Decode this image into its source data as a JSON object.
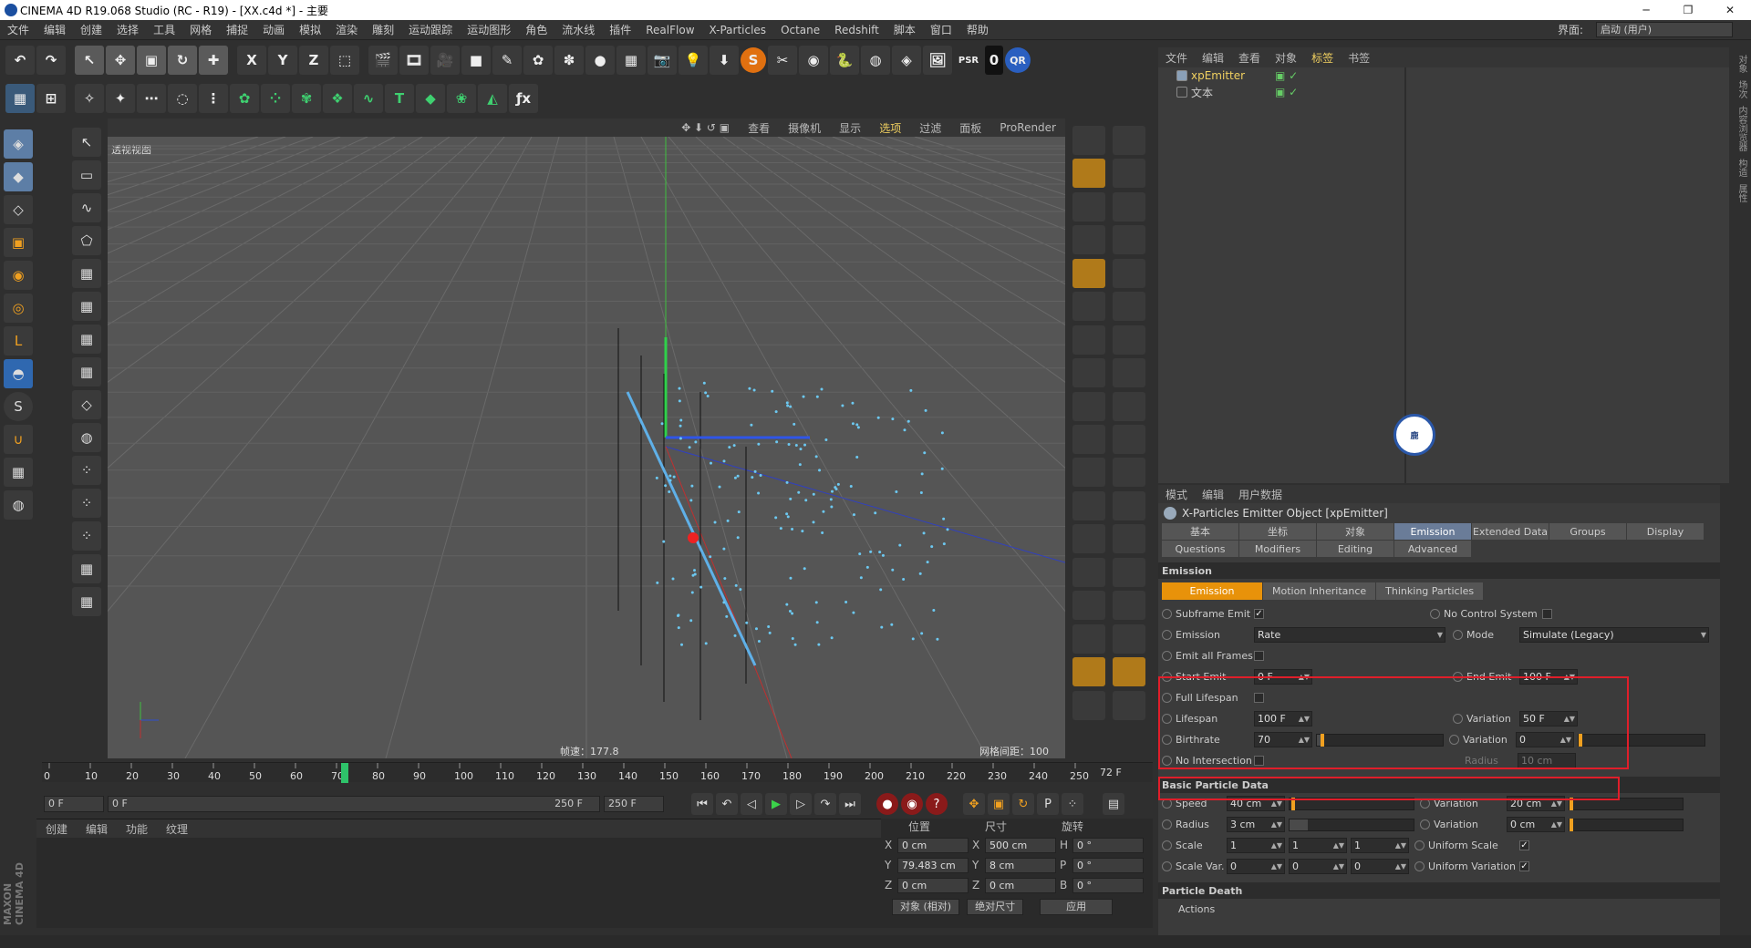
{
  "window": {
    "title": "CINEMA 4D R19.068 Studio (RC - R19) - [XX.c4d *] - 主要",
    "min": "─",
    "max": "❐",
    "close": "✕"
  },
  "menu": [
    "文件",
    "编辑",
    "创建",
    "选择",
    "工具",
    "网格",
    "捕捉",
    "动画",
    "模拟",
    "渲染",
    "雕刻",
    "运动跟踪",
    "运动图形",
    "角色",
    "流水线",
    "插件",
    "RealFlow",
    "X-Particles",
    "Octane",
    "Redshift",
    "脚本",
    "窗口",
    "帮助"
  ],
  "interface": {
    "label": "界面:",
    "value": "启动 (用户)"
  },
  "toolbar1": [
    "↶",
    "↷",
    "↖",
    "✥",
    "▣",
    "↻",
    "✚",
    "X",
    "Y",
    "Z",
    "⬚",
    "🎬",
    "🎞",
    "🎥",
    "■",
    "✎",
    "✿",
    "✽",
    "●",
    "▦",
    "📷",
    "💡",
    "⬇",
    "S",
    "✂",
    "◉",
    "🐍",
    "◍",
    "◈",
    "🖼",
    "PSR",
    "0",
    "QR"
  ],
  "toolbar2": [
    "▦",
    "⊞",
    "✧",
    "✦",
    "⋯",
    "◌",
    "⋮",
    "✿",
    "⁘",
    "✾",
    "❖",
    "∿",
    "T",
    "◆",
    "❀",
    "◭",
    "ƒx"
  ],
  "left_tools": [
    "◈",
    "◆",
    "◇",
    "▣",
    "◉",
    "◎",
    "L",
    "◓",
    "S",
    "∪",
    "▦",
    "◍"
  ],
  "viewport": {
    "menu": [
      "查看",
      "摄像机",
      "显示",
      "选项",
      "过滤",
      "面板",
      "ProRender"
    ],
    "active": "选项",
    "label": "透视视图",
    "speed": "帧速：177.8",
    "grid": "网格间距：100 cm"
  },
  "timeline": {
    "ticks": [
      "0",
      "10",
      "20",
      "30",
      "40",
      "50",
      "60",
      "70",
      "72",
      "80",
      "90",
      "100",
      "110",
      "120",
      "130",
      "140",
      "150",
      "160",
      "170",
      "180",
      "190",
      "200",
      "210",
      "220",
      "230",
      "240",
      "250"
    ],
    "current_frame": "72 F",
    "start": "0 F",
    "start2": "0 F",
    "end_in": "250 F",
    "end": "250 F"
  },
  "material_menu": [
    "创建",
    "编辑",
    "功能",
    "纹理"
  ],
  "maxon": "MAXON CINEMA 4D",
  "coords": {
    "headers": [
      "位置",
      "尺寸",
      "旋转"
    ],
    "rows": [
      {
        "a": "X",
        "v1": "0 cm",
        "b": "X",
        "v2": "500 cm",
        "c": "H",
        "v3": "0 °"
      },
      {
        "a": "Y",
        "v1": "79.483 cm",
        "b": "Y",
        "v2": "8 cm",
        "c": "P",
        "v3": "0 °"
      },
      {
        "a": "Z",
        "v1": "0 cm",
        "b": "Z",
        "v2": "0 cm",
        "c": "B",
        "v3": "0 °"
      }
    ],
    "mode": "对象 (相对)",
    "size_mode": "绝对尺寸",
    "apply": "应用"
  },
  "objects": {
    "menu": [
      "文件",
      "编辑",
      "查看",
      "对象",
      "标签",
      "书签"
    ],
    "active": "标签",
    "items": [
      {
        "name": "xpEmitter",
        "color": "#f0d060"
      },
      {
        "name": "文本",
        "color": "#ccc"
      }
    ]
  },
  "badge": "鹿",
  "attributes": {
    "menu": [
      "模式",
      "编辑",
      "用户数据"
    ],
    "title": "X-Particles Emitter Object [xpEmitter]",
    "tabs": [
      "基本",
      "坐标",
      "对象",
      "Emission",
      "Extended Data",
      "Groups",
      "Display",
      "Questions",
      "Modifiers",
      "Editing",
      "Advanced"
    ],
    "active_tab": "Emission",
    "section": "Emission",
    "subtabs": [
      "Emission",
      "Motion Inheritance",
      "Thinking Particles"
    ],
    "subframe": "Subframe Emit",
    "subframe_chk": "✓",
    "no_control": "No Control System",
    "emission_lbl": "Emission",
    "emission_val": "Rate",
    "mode_lbl": "Mode",
    "mode_val": "Simulate (Legacy)",
    "emit_all": "Emit all Frames",
    "start_emit": "Start Emit",
    "start_val": "0 F",
    "end_emit": "End Emit",
    "end_val": "100 F",
    "full_life": "Full Lifespan",
    "lifespan": "Lifespan",
    "life_val": "100 F",
    "var1": "Variation",
    "var1_val": "50 F",
    "birthrate": "Birthrate",
    "birth_val": "70",
    "var2": "Variation",
    "var2_val": "0",
    "no_inter": "No Intersection",
    "radius_dim": "Radius",
    "radius_dim_val": "10 cm",
    "basic_section": "Basic Particle Data",
    "speed": "Speed",
    "speed_val": "40 cm",
    "svar": "Variation",
    "svar_val": "20 cm",
    "radius": "Radius",
    "radius_val": "3 cm",
    "rvar": "Variation",
    "rvar_val": "0 cm",
    "scale": "Scale",
    "s1": "1",
    "s2": "1",
    "s3": "1",
    "uscale": "Uniform Scale",
    "uscale_chk": "✓",
    "scalevar": "Scale Var.",
    "sv1": "0",
    "sv2": "0",
    "sv3": "0",
    "uvar": "Uniform Variation",
    "uvar_chk": "✓",
    "death_section": "Particle Death",
    "actions": "Actions"
  },
  "side_tabs": [
    "对象",
    "场次",
    "内容浏览器",
    "构造",
    "属性"
  ]
}
